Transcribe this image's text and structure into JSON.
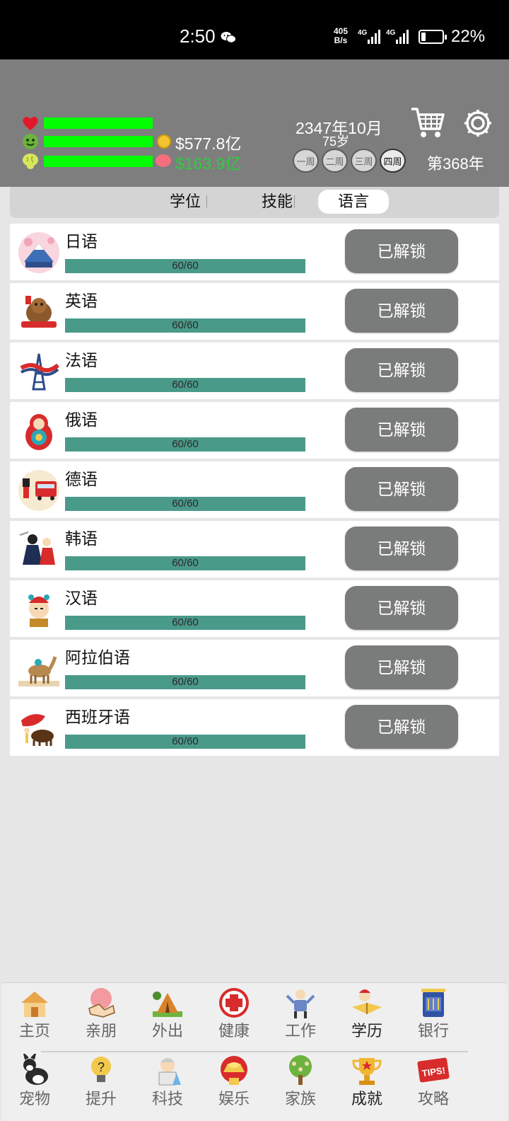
{
  "status_bar": {
    "time": "2:50",
    "net_speed_top": "405",
    "net_speed_bottom": "B/s",
    "signal1": "4G",
    "signal2": "4G",
    "battery_percent": "22%",
    "battery_level": 0.22
  },
  "header": {
    "stats": [
      {
        "name": "health",
        "icon": "heart-icon",
        "level": 1.0
      },
      {
        "name": "happiness",
        "icon": "smiley-icon",
        "level": 1.0
      },
      {
        "name": "smarts",
        "icon": "brain-icon",
        "level": 1.0
      }
    ],
    "cash": "$577.8亿",
    "savings": "$163.9亿",
    "date": "2347年10月",
    "age": "75岁",
    "weeks": [
      "一周",
      "二周",
      "三周",
      "四周"
    ],
    "active_week": 3,
    "year": "第368年",
    "colors": {
      "bar": "#00ff00",
      "cash": "#ffffff",
      "savings": "#2ecc40",
      "header_bg": "#7e7e7e"
    }
  },
  "tabs": [
    {
      "label": "学位",
      "active": false
    },
    {
      "label": "技能",
      "active": false
    },
    {
      "label": "语言",
      "active": true
    }
  ],
  "languages": [
    {
      "name": "日语",
      "progress": "60/60",
      "fraction": 1.0,
      "button": "已解锁",
      "icon": "japan-icon"
    },
    {
      "name": "英语",
      "progress": "60/60",
      "fraction": 1.0,
      "button": "已解锁",
      "icon": "canada-beaver-icon"
    },
    {
      "name": "法语",
      "progress": "60/60",
      "fraction": 1.0,
      "button": "已解锁",
      "icon": "eiffel-tower-icon"
    },
    {
      "name": "俄语",
      "progress": "60/60",
      "fraction": 1.0,
      "button": "已解锁",
      "icon": "matryoshka-icon"
    },
    {
      "name": "德语",
      "progress": "60/60",
      "fraction": 1.0,
      "button": "已解锁",
      "icon": "london-bus-icon"
    },
    {
      "name": "韩语",
      "progress": "60/60",
      "fraction": 1.0,
      "button": "已解锁",
      "icon": "korean-dancer-icon"
    },
    {
      "name": "汉语",
      "progress": "60/60",
      "fraction": 1.0,
      "button": "已解锁",
      "icon": "peking-opera-icon"
    },
    {
      "name": "阿拉伯语",
      "progress": "60/60",
      "fraction": 1.0,
      "button": "已解锁",
      "icon": "camel-icon"
    },
    {
      "name": "西班牙语",
      "progress": "60/60",
      "fraction": 1.0,
      "button": "已解锁",
      "icon": "bullfighter-icon"
    }
  ],
  "bottom_nav": {
    "row1": [
      {
        "label": "主页",
        "icon": "home-icon"
      },
      {
        "label": "亲朋",
        "icon": "handshake-icon"
      },
      {
        "label": "外出",
        "icon": "tent-icon"
      },
      {
        "label": "健康",
        "icon": "medical-cross-icon"
      },
      {
        "label": "工作",
        "icon": "worker-icon"
      },
      {
        "label": "学历",
        "icon": "student-reading-icon"
      },
      {
        "label": "银行",
        "icon": "bank-icon"
      }
    ],
    "row2": [
      {
        "label": "宠物",
        "icon": "dog-icon"
      },
      {
        "label": "提升",
        "icon": "lightbulb-icon"
      },
      {
        "label": "科技",
        "icon": "scientist-icon"
      },
      {
        "label": "娱乐",
        "icon": "gold-ingot-icon"
      },
      {
        "label": "家族",
        "icon": "family-tree-icon"
      },
      {
        "label": "成就",
        "icon": "trophy-icon"
      },
      {
        "label": "攻略",
        "icon": "tips-icon"
      }
    ]
  }
}
